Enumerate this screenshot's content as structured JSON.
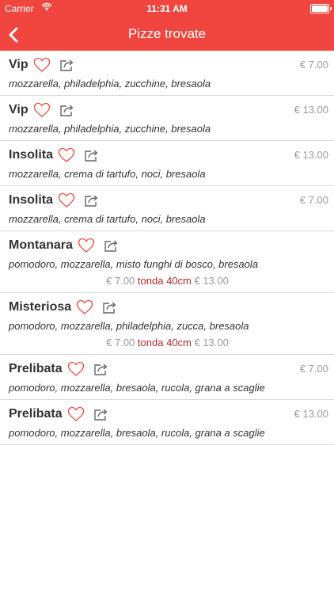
{
  "status": {
    "carrier": "Carrier",
    "time": "11:31 AM"
  },
  "nav": {
    "title": "Pizze trovate"
  },
  "colors": {
    "accent": "#f0463f",
    "heart": "#f0463f",
    "size_text": "#b02a2a",
    "price_gray": "#9a9a9a"
  },
  "items": [
    {
      "name": "Vip",
      "ingredients": "mozzarella, philadelphia, zucchine, bresaola",
      "price": "€ 7.00"
    },
    {
      "name": "Vip",
      "ingredients": "mozzarella, philadelphia, zucchine, bresaola",
      "price": "€ 13.00"
    },
    {
      "name": "Insolita",
      "ingredients": "mozzarella, crema di tartufo, noci, bresaola",
      "price": "€ 13.00"
    },
    {
      "name": "Insolita",
      "ingredients": "mozzarella, crema di tartufo, noci, bresaola",
      "price": "€ 7.00"
    },
    {
      "name": "Montanara",
      "ingredients": "pomodoro, mozzarella, misto funghi di bosco, bresaola",
      "price_from": "€ 7.00",
      "size": "tonda 40cm",
      "price_to": "€ 13.00"
    },
    {
      "name": "Misteriosa",
      "ingredients": "pomodoro, mozzarella, philadelphia, zucca, bresaola",
      "price_from": "€ 7.00",
      "size": "tonda 40cm",
      "price_to": "€ 13.00"
    },
    {
      "name": "Prelibata",
      "ingredients": "pomodoro, mozzarella, bresaola, rucola, grana a scaglie",
      "price": "€ 7.00"
    },
    {
      "name": "Prelibata",
      "ingredients": "pomodoro, mozzarella, bresaola, rucola, grana a scaglie",
      "price": "€ 13.00"
    }
  ]
}
